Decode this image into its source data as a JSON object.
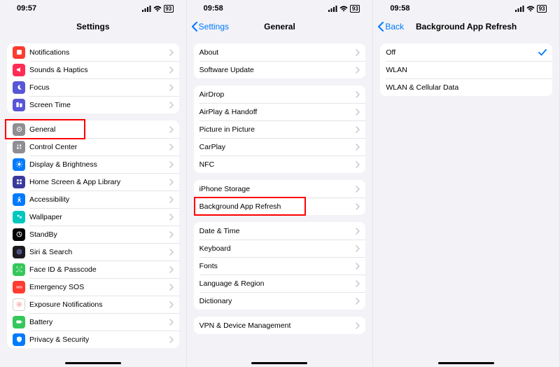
{
  "status": {
    "time1": "09:57",
    "time2": "09:58",
    "time3": "09:58",
    "battery": "93"
  },
  "screen1": {
    "title": "Settings",
    "groups": [
      [
        {
          "label": "Notifications",
          "icon": "notifications",
          "bg": "#ff3b30"
        },
        {
          "label": "Sounds & Haptics",
          "icon": "sounds",
          "bg": "#ff2d55"
        },
        {
          "label": "Focus",
          "icon": "focus",
          "bg": "#5856d6"
        },
        {
          "label": "Screen Time",
          "icon": "screentime",
          "bg": "#5856d6"
        }
      ],
      [
        {
          "label": "General",
          "icon": "general",
          "bg": "#8e8e93",
          "highlight": true
        },
        {
          "label": "Control Center",
          "icon": "controlcenter",
          "bg": "#8e8e93"
        },
        {
          "label": "Display & Brightness",
          "icon": "display",
          "bg": "#007aff"
        },
        {
          "label": "Home Screen & App Library",
          "icon": "homescreen",
          "bg": "#3a3a9e"
        },
        {
          "label": "Accessibility",
          "icon": "accessibility",
          "bg": "#007aff"
        },
        {
          "label": "Wallpaper",
          "icon": "wallpaper",
          "bg": "#00c7be"
        },
        {
          "label": "StandBy",
          "icon": "standby",
          "bg": "#000000"
        },
        {
          "label": "Siri & Search",
          "icon": "siri",
          "bg": "#1c1c1e"
        },
        {
          "label": "Face ID & Passcode",
          "icon": "faceid",
          "bg": "#34c759"
        },
        {
          "label": "Emergency SOS",
          "icon": "sos",
          "bg": "#ff3b30"
        },
        {
          "label": "Exposure Notifications",
          "icon": "exposure",
          "bg": "#ffffff",
          "border": true
        },
        {
          "label": "Battery",
          "icon": "battery",
          "bg": "#34c759"
        },
        {
          "label": "Privacy & Security",
          "icon": "privacy",
          "bg": "#007aff"
        }
      ]
    ]
  },
  "screen2": {
    "back": "Settings",
    "title": "General",
    "groups": [
      [
        {
          "label": "About"
        },
        {
          "label": "Software Update"
        }
      ],
      [
        {
          "label": "AirDrop"
        },
        {
          "label": "AirPlay & Handoff"
        },
        {
          "label": "Picture in Picture"
        },
        {
          "label": "CarPlay"
        },
        {
          "label": "NFC"
        }
      ],
      [
        {
          "label": "iPhone Storage"
        },
        {
          "label": "Background App Refresh",
          "highlight": true
        }
      ],
      [
        {
          "label": "Date & Time"
        },
        {
          "label": "Keyboard"
        },
        {
          "label": "Fonts"
        },
        {
          "label": "Language & Region"
        },
        {
          "label": "Dictionary"
        }
      ],
      [
        {
          "label": "VPN & Device Management"
        }
      ]
    ]
  },
  "screen3": {
    "back": "Back",
    "title": "Background App Refresh",
    "options": [
      {
        "label": "Off",
        "selected": true
      },
      {
        "label": "WLAN"
      },
      {
        "label": "WLAN & Cellular Data"
      }
    ]
  }
}
